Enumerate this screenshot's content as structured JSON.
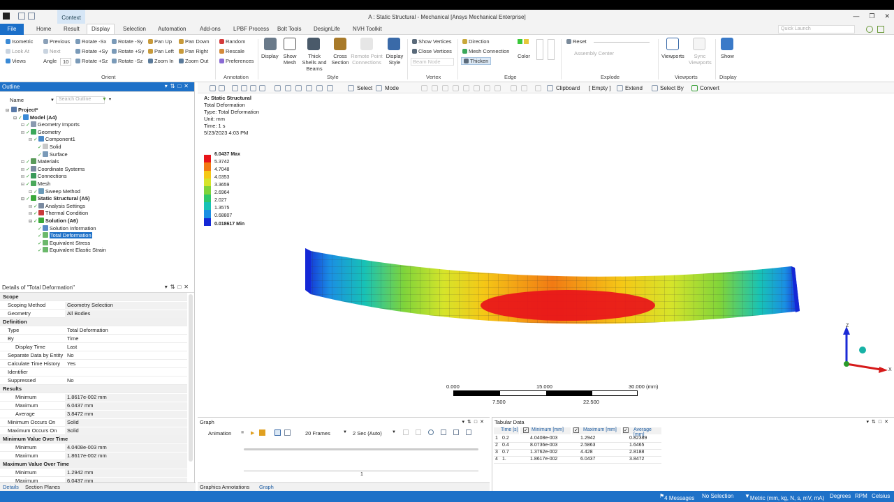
{
  "window": {
    "title": "A : Static Structural - Mechanical [Ansys Mechanical Enterprise]",
    "context_tab": "Context",
    "quick_launch_placeholder": "Quick Launch"
  },
  "tabs": [
    "File",
    "Home",
    "Result",
    "Display",
    "Selection",
    "Automation",
    "Add-ons",
    "LPBF Process",
    "Bolt Tools",
    "DesignLife",
    "NVH Toolkit"
  ],
  "ribbon": {
    "orient": {
      "items": [
        "Isometric",
        "Previous",
        "Rotate -Sx",
        "Rotate -Sy",
        "Rotate -Sy",
        "Pan Up",
        "Pan Down",
        "Look At",
        "Next",
        "Rotate +Sy",
        "Rotate +Sy",
        "Pan Left",
        "Pan Right",
        "Views",
        "Angle",
        "Rotate +Sz",
        "Rotate -Sz",
        "Zoom In",
        "Zoom Out"
      ],
      "angle_value": "10",
      "group_label": "Orient"
    },
    "annotation": {
      "items": [
        "Random",
        "Rescale",
        "Preferences"
      ],
      "group_label": "Annotation"
    },
    "style": {
      "items": [
        "Display",
        "Show Mesh",
        "Thick Shells and Beams",
        "Cross Section",
        "Remote Point Connections",
        "Display Style"
      ],
      "group_label": "Style"
    },
    "vertex": {
      "items": [
        "Show Vertices",
        "Close Vertices",
        "Beam Node"
      ],
      "group_label": "Vertex"
    },
    "edge": {
      "items": [
        "Direction",
        "Mesh Connection",
        "Thicken",
        "Color"
      ],
      "group_label": "Edge"
    },
    "explode": {
      "items": [
        "Reset",
        "Assembly Center"
      ],
      "group_label": "Explode"
    },
    "viewports": {
      "items": [
        "Viewports",
        "Sync Viewports"
      ],
      "group_label": "Viewports"
    },
    "display": {
      "items": [
        "Show"
      ],
      "group_label": "Display"
    }
  },
  "toolbar": {
    "select": "Select",
    "mode": "Mode",
    "clipboard": "Clipboard",
    "empty": "[ Empty ]",
    "extend": "Extend",
    "select_by": "Select By",
    "convert": "Convert"
  },
  "outline": {
    "title": "Outline",
    "name_label": "Name",
    "search_placeholder": "Search Outline",
    "tree": [
      {
        "label": "Project*",
        "level": 0,
        "bold": true
      },
      {
        "label": "Model (A4)",
        "level": 1,
        "bold": true
      },
      {
        "label": "Geometry Imports",
        "level": 2
      },
      {
        "label": "Geometry",
        "level": 2
      },
      {
        "label": "Component1",
        "level": 3
      },
      {
        "label": "Solid",
        "level": 4
      },
      {
        "label": "Surface",
        "level": 4
      },
      {
        "label": "Materials",
        "level": 2
      },
      {
        "label": "Coordinate Systems",
        "level": 2
      },
      {
        "label": "Connections",
        "level": 2
      },
      {
        "label": "Mesh",
        "level": 2
      },
      {
        "label": "Sweep Method",
        "level": 3
      },
      {
        "label": "Static Structural (A5)",
        "level": 2,
        "bold": true
      },
      {
        "label": "Analysis Settings",
        "level": 3
      },
      {
        "label": "Thermal Condition",
        "level": 3
      },
      {
        "label": "Solution (A6)",
        "level": 3,
        "bold": true
      },
      {
        "label": "Solution Information",
        "level": 4
      },
      {
        "label": "Total Deformation",
        "level": 4,
        "selected": true
      },
      {
        "label": "Equivalent Stress",
        "level": 4
      },
      {
        "label": "Equivalent Elastic Strain",
        "level": 4
      }
    ]
  },
  "details": {
    "title": "Details of \"Total Deformation\"",
    "rows": [
      {
        "k": "Scope",
        "section": true
      },
      {
        "k": "Scoping Method",
        "v": "Geometry Selection",
        "hl": true
      },
      {
        "k": "Geometry",
        "v": "All Bodies",
        "hl": true
      },
      {
        "k": "Definition",
        "section": true
      },
      {
        "k": "Type",
        "v": "Total Deformation"
      },
      {
        "k": "By",
        "v": "Time"
      },
      {
        "k": "Display Time",
        "v": "Last",
        "indent": true
      },
      {
        "k": "Separate Data by Entity",
        "v": "No"
      },
      {
        "k": "Calculate Time History",
        "v": "Yes"
      },
      {
        "k": "Identifier",
        "v": ""
      },
      {
        "k": "Suppressed",
        "v": "No"
      },
      {
        "k": "Results",
        "section": true
      },
      {
        "k": "Minimum",
        "v": "1.8617e-002 mm",
        "indent": true,
        "hl": true
      },
      {
        "k": "Maximum",
        "v": "6.0437 mm",
        "indent": true,
        "hl": true
      },
      {
        "k": "Average",
        "v": "3.8472 mm",
        "indent": true,
        "hl": true
      },
      {
        "k": "Minimum Occurs On",
        "v": "Solid",
        "hl": true
      },
      {
        "k": "Maximum Occurs On",
        "v": "Solid",
        "hl": true
      },
      {
        "k": "Minimum Value Over Time",
        "section": true
      },
      {
        "k": "Minimum",
        "v": "4.0408e-003 mm",
        "indent": true,
        "hl": true
      },
      {
        "k": "Maximum",
        "v": "1.8617e-002 mm",
        "indent": true,
        "hl": true
      },
      {
        "k": "Maximum Value Over Time",
        "section": true
      },
      {
        "k": "Minimum",
        "v": "1.2942 mm",
        "indent": true,
        "hl": true
      },
      {
        "k": "Maximum",
        "v": "6.0437 mm",
        "indent": true,
        "hl": true
      }
    ]
  },
  "bottom_tabs": {
    "left": [
      "Details",
      "Section Planes"
    ],
    "center": [
      "Graphics Annotations",
      "Graph"
    ]
  },
  "viewport": {
    "info": [
      "A: Static Structural",
      "Total Deformation",
      "Type: Total Deformation",
      "Unit: mm",
      "Time: 1 s",
      "5/23/2023 4:03 PM"
    ],
    "legend": {
      "max_label": "6.0437 Max",
      "values": [
        "5.3742",
        "4.7048",
        "4.0353",
        "3.3659",
        "2.6964",
        "2.027",
        "1.3575",
        "0.68807"
      ],
      "min_label": "0.018617 Min",
      "colors": [
        "#e8141a",
        "#f27a13",
        "#f5c816",
        "#d6e42a",
        "#7fd43a",
        "#2fc86a",
        "#17c2b6",
        "#1a8fe3",
        "#1428d6"
      ]
    },
    "scale": {
      "ticks_top": [
        "0.000",
        "15.000",
        "30.000 (mm)"
      ],
      "ticks_bottom": [
        "7.500",
        "22.500"
      ]
    },
    "triad": {
      "z": "Z",
      "x": "X"
    }
  },
  "graph": {
    "title": "Graph",
    "animation": "Animation",
    "frames": "20 Frames",
    "duration": "2 Sec (Auto)",
    "axis_value": "1"
  },
  "tabular": {
    "title": "Tabular Data",
    "headers": [
      "Time [s]",
      "Minimum [mm]",
      "Maximum [mm]",
      "Average [mm]"
    ],
    "rows": [
      [
        "1",
        "0.2",
        "4.0408e-003",
        "1.2942",
        "0.82389"
      ],
      [
        "2",
        "0.4",
        "8.0736e-003",
        "2.5863",
        "1.6465"
      ],
      [
        "3",
        "0.7",
        "1.3762e-002",
        "4.428",
        "2.8188"
      ],
      [
        "4",
        "1.",
        "1.8617e-002",
        "6.0437",
        "3.8472"
      ]
    ]
  },
  "status": {
    "messages": "4 Messages",
    "selection": "No Selection",
    "units": "Metric (mm, kg, N, s, mV, mA)",
    "angle": "Degrees",
    "rpm": "RPM",
    "temp": "Celsius"
  }
}
